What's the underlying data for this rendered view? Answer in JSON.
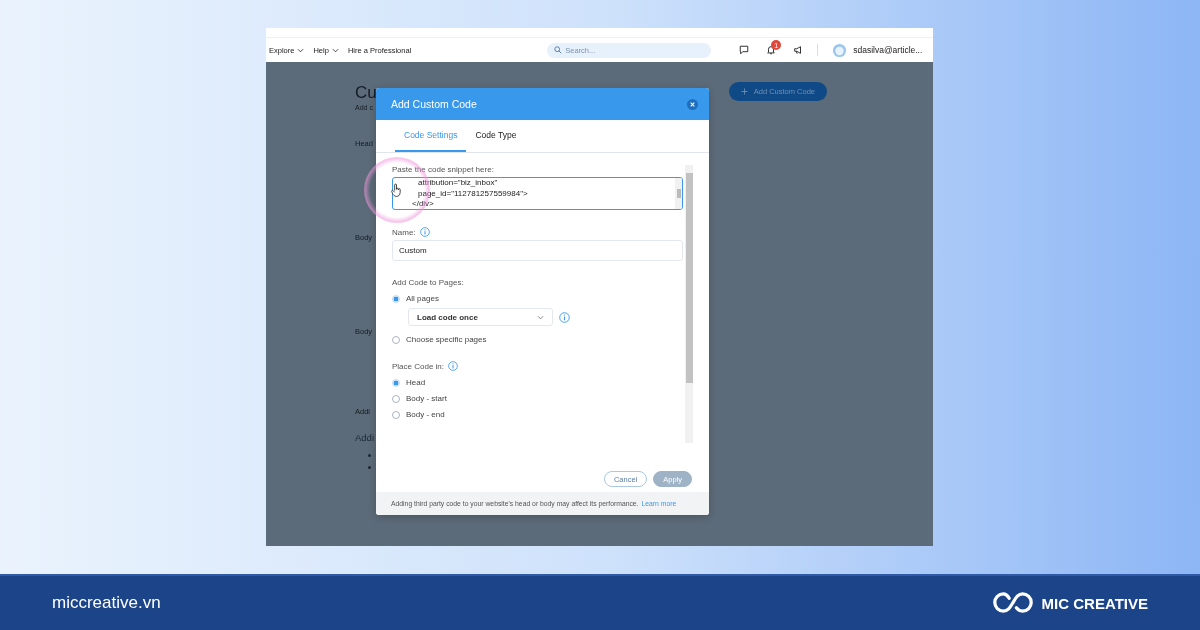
{
  "nav": {
    "items": [
      {
        "label": "Explore",
        "dropdown": true
      },
      {
        "label": "Help",
        "dropdown": true
      },
      {
        "label": "Hire a Professional",
        "dropdown": false
      }
    ],
    "search": {
      "placeholder": "Search..."
    },
    "notification_badge": "1",
    "account": "sdasilva@article..."
  },
  "page": {
    "title": "Cu",
    "subtitle": "Add c",
    "add_button": "Add Custom Code",
    "sections": [
      {
        "kind": "label",
        "text": "Head"
      },
      {
        "kind": "label",
        "text": "Body"
      },
      {
        "kind": "label",
        "text": "Body"
      },
      {
        "kind": "note",
        "text": "Addi"
      },
      {
        "kind": "heading",
        "text": "Addi"
      },
      {
        "kind": "bullet"
      },
      {
        "kind": "bullet"
      }
    ]
  },
  "modal": {
    "title": "Add Custom Code",
    "tabs": [
      {
        "label": "Code Settings",
        "selected": true
      },
      {
        "label": "Code Type",
        "selected": false
      }
    ],
    "snippet": {
      "label": "Paste the code snippet here:",
      "lines": [
        "attribution=\"biz_inbox\"",
        "page_id=\"112781257559984\">",
        "</div>"
      ]
    },
    "name": {
      "label": "Name:",
      "value": "Custom"
    },
    "pages": {
      "label": "Add Code to Pages:",
      "options": [
        {
          "kind": "radio",
          "label": "All pages",
          "selected": true
        },
        {
          "kind": "dropdown",
          "value": "Load code once"
        },
        {
          "kind": "radio",
          "label": "Choose specific pages",
          "selected": false
        }
      ]
    },
    "place": {
      "label": "Place Code in:",
      "options": [
        {
          "kind": "radio",
          "label": "Head",
          "selected": true
        },
        {
          "kind": "radio",
          "label": "Body - start",
          "selected": false
        },
        {
          "kind": "radio",
          "label": "Body - end",
          "selected": false
        }
      ]
    },
    "buttons": [
      {
        "label": "Cancel",
        "disabled": false
      },
      {
        "label": "Apply",
        "disabled": true
      }
    ],
    "footer": {
      "text": "Adding third party code to your website's head or body may affect its performance.",
      "link": "Learn more"
    }
  },
  "banner": {
    "site": "miccreative.vn",
    "brand": "MIC CREATIVE"
  }
}
